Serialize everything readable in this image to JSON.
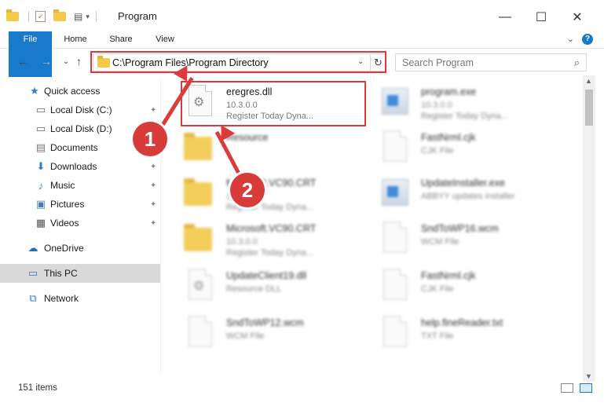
{
  "window": {
    "title": "Program",
    "minimize": "—",
    "maximize": "☐",
    "close": "✕"
  },
  "ribbon": {
    "tabs": [
      "File",
      "Home",
      "Share",
      "View"
    ],
    "collapse": "⌄",
    "help": "?"
  },
  "nav": {
    "back": "←",
    "forward": "→",
    "recent": "⌄",
    "up": "↑"
  },
  "address": {
    "path": "C:\\Program Files\\Program Directory",
    "dropdown": "⌄",
    "refresh": "↻"
  },
  "search": {
    "placeholder": "Search Program",
    "icon": "⌕"
  },
  "sidebar": {
    "items": [
      {
        "label": "Quick access",
        "icon": "star-icon",
        "glyph": "★",
        "pinned": false
      },
      {
        "label": "Local Disk (C:)",
        "icon": "drive-icon",
        "glyph": "▭",
        "pinned": true
      },
      {
        "label": "Local Disk (D:)",
        "icon": "drive-icon",
        "glyph": "▭",
        "pinned": false
      },
      {
        "label": "Documents",
        "icon": "documents-icon",
        "glyph": "▤",
        "pinned": false
      },
      {
        "label": "Downloads",
        "icon": "downloads-icon",
        "glyph": "⬇",
        "pinned": true
      },
      {
        "label": "Music",
        "icon": "music-icon",
        "glyph": "♪",
        "pinned": true
      },
      {
        "label": "Pictures",
        "icon": "pictures-icon",
        "glyph": "▣",
        "pinned": true
      },
      {
        "label": "Videos",
        "icon": "videos-icon",
        "glyph": "▦",
        "pinned": true
      },
      {
        "label": "OneDrive",
        "icon": "cloud-icon",
        "glyph": "☁",
        "pinned": false
      },
      {
        "label": "This PC",
        "icon": "computer-icon",
        "glyph": "▭",
        "pinned": false
      },
      {
        "label": "Network",
        "icon": "network-icon",
        "glyph": "⧉",
        "pinned": false
      }
    ],
    "pin_glyph": "📌"
  },
  "files": [
    {
      "name": "eregres.dll",
      "line1": "10.3.0.0",
      "line2": "Register Today Dyna...",
      "type": "dll"
    },
    {
      "name": "program.exe",
      "line1": "10.3.0.0",
      "line2": "Register Today Dyna...",
      "type": "exe"
    },
    {
      "name": "Resource",
      "line1": "",
      "line2": "",
      "type": "folder"
    },
    {
      "name": "FastNrml.cjk",
      "line1": "CJK File",
      "line2": "",
      "type": "doc"
    },
    {
      "name": "Microsoft.VC90.CRT",
      "line1": "10.3.0.0",
      "line2": "Register Today Dyna...",
      "type": "folder"
    },
    {
      "name": "UpdateInstaller.exe",
      "line1": "ABBYY updates installer",
      "line2": "",
      "type": "exe"
    },
    {
      "name": "Microsoft.VC90.CRT",
      "line1": "10.3.0.0",
      "line2": "Register Today Dyna...",
      "type": "folder"
    },
    {
      "name": "SndToWP16.wcm",
      "line1": "WCM File",
      "line2": "",
      "type": "doc"
    },
    {
      "name": "UpdateClient19.dll",
      "line1": "Resource DLL",
      "line2": "",
      "type": "dll"
    },
    {
      "name": "FastNrml.cjk",
      "line1": "CJK File",
      "line2": "",
      "type": "doc"
    },
    {
      "name": "SndToWP12.wcm",
      "line1": "WCM File",
      "line2": "",
      "type": "doc"
    },
    {
      "name": "help.fineReader.txt",
      "line1": "TXT File",
      "line2": "",
      "type": "doc"
    }
  ],
  "annotations": {
    "badge1": "1",
    "badge2": "2"
  },
  "status": {
    "count": "151 items"
  },
  "colors": {
    "accent": "#1979ca",
    "highlight": "#dd3b3b",
    "selected": "#d9d9d9"
  }
}
